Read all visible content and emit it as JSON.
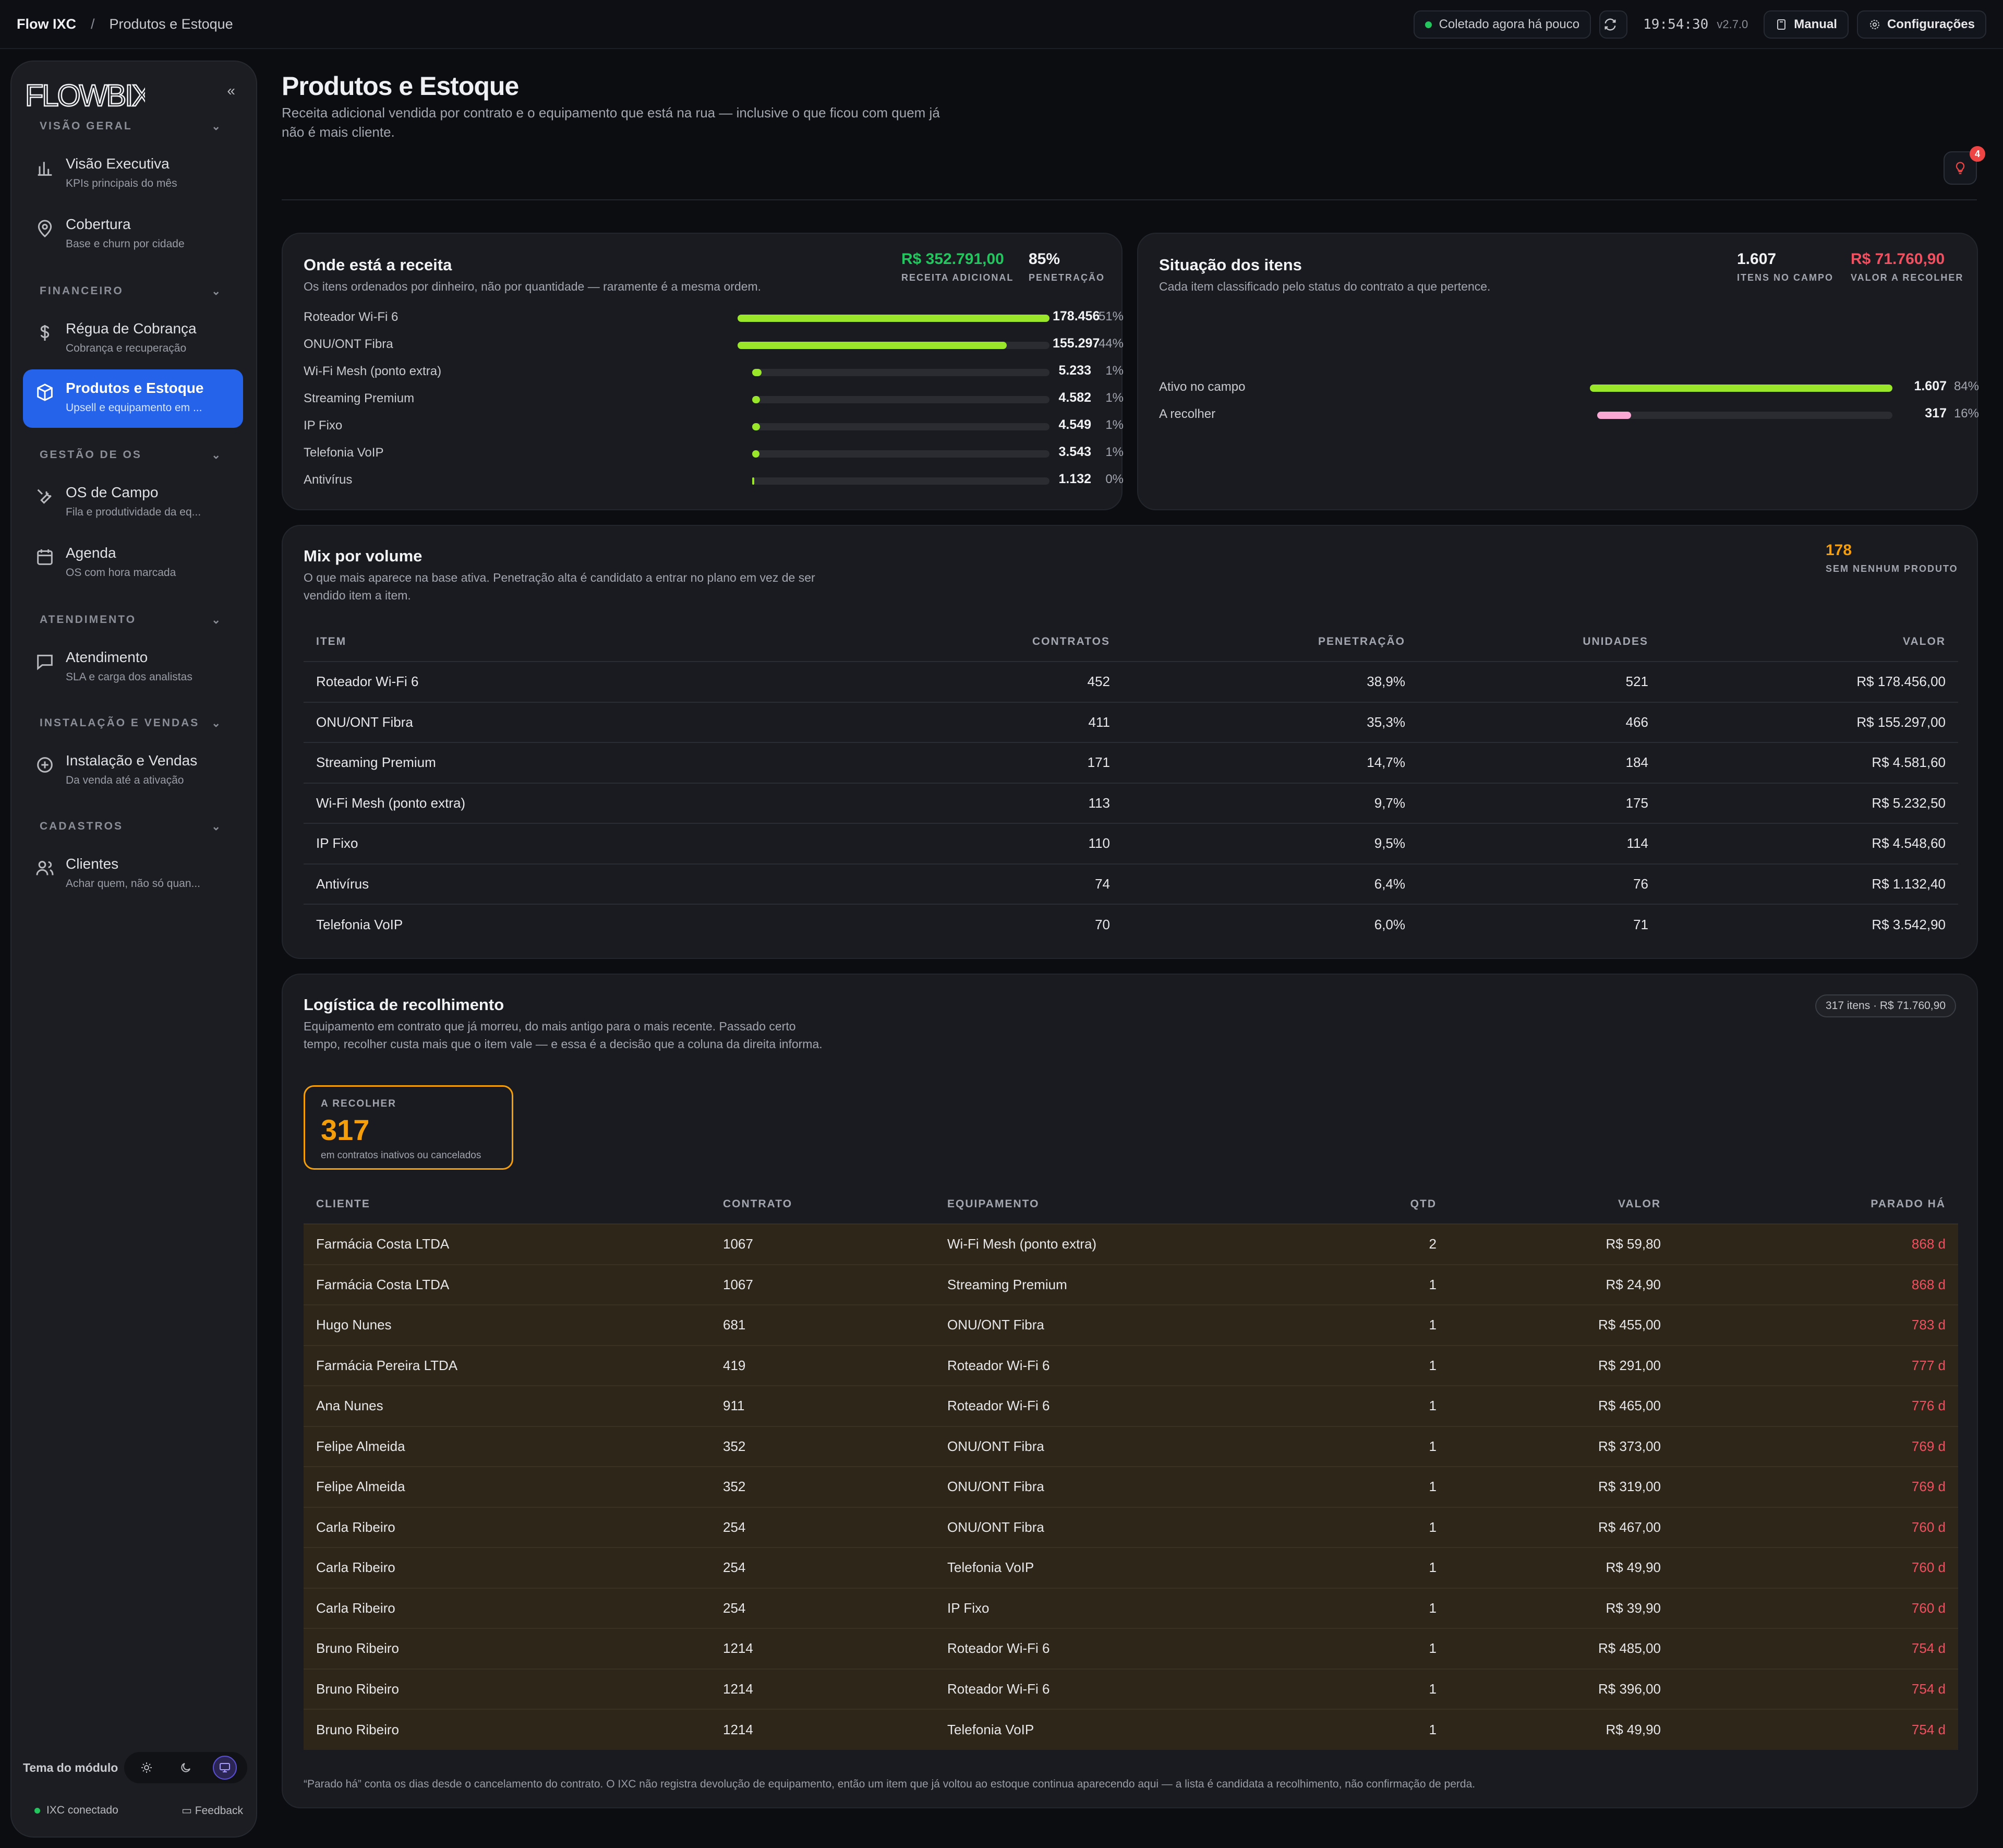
{
  "topbar": {
    "brand": "Flow IXC",
    "separator": "/",
    "page": "Produtos e Estoque",
    "status": "Coletado agora há pouco",
    "clock": "19:54:30",
    "version": "v2.7.0",
    "manual": "Manual",
    "settings": "Configurações"
  },
  "sidebar": {
    "logo": "FLOWBIX",
    "collapse": "«",
    "sections": [
      {
        "label": "VISÃO GERAL",
        "items": [
          {
            "title": "Visão Executiva",
            "subtitle": "KPIs principais do mês",
            "icon": "bar-chart-icon"
          },
          {
            "title": "Cobertura",
            "subtitle": "Base e churn por cidade",
            "icon": "map-pin-icon"
          }
        ]
      },
      {
        "label": "FINANCEIRO",
        "items": [
          {
            "title": "Régua de Cobrança",
            "subtitle": "Cobrança e recuperação",
            "icon": "dollar-icon"
          },
          {
            "title": "Produtos e Estoque",
            "subtitle": "Upsell e equipamento em ...",
            "icon": "box-icon"
          }
        ]
      },
      {
        "label": "GESTÃO DE OS",
        "items": [
          {
            "title": "OS de Campo",
            "subtitle": "Fila e produtividade da eq...",
            "icon": "wrench-icon"
          },
          {
            "title": "Agenda",
            "subtitle": "OS com hora marcada",
            "icon": "calendar-icon"
          }
        ]
      },
      {
        "label": "ATENDIMENTO",
        "items": [
          {
            "title": "Atendimento",
            "subtitle": "SLA e carga dos analistas",
            "icon": "chat-icon"
          }
        ]
      },
      {
        "label": "INSTALAÇÃO E VENDAS",
        "items": [
          {
            "title": "Instalação e Vendas",
            "subtitle": "Da venda até a ativação",
            "icon": "plus-circle-icon"
          }
        ]
      },
      {
        "label": "CADASTROS",
        "items": [
          {
            "title": "Clientes",
            "subtitle": "Achar quem, não só quan...",
            "icon": "users-icon"
          }
        ]
      }
    ],
    "theme_label": "Tema do módulo",
    "connected": "IXC conectado",
    "feedback": "Feedback"
  },
  "page": {
    "title": "Produtos e Estoque",
    "subtitle": "Receita adicional vendida por contrato e o equipamento que está na rua — inclusive o que ficou com quem já não é mais cliente.",
    "alerts_badge": "4"
  },
  "revenue_card": {
    "title": "Onde está a receita",
    "subtitle": "Os itens ordenados por dinheiro, não por quantidade — raramente é a mesma ordem.",
    "kpi_value": "R$ 352.791,00",
    "kpi_label": "RECEITA ADICIONAL",
    "kpi2_value": "85%",
    "kpi2_label": "PENETRAÇÃO",
    "rows": [
      {
        "name": "Roteador Wi-Fi 6",
        "value": "178.456",
        "pct": "51%",
        "fraction": 0.51
      },
      {
        "name": "ONU/ONT Fibra",
        "value": "155.297",
        "pct": "44%",
        "fraction": 0.44
      },
      {
        "name": "Wi-Fi Mesh (ponto extra)",
        "value": "5.233",
        "pct": "1%",
        "fraction": 0.015
      },
      {
        "name": "Streaming Premium",
        "value": "4.582",
        "pct": "1%",
        "fraction": 0.013
      },
      {
        "name": "IP Fixo",
        "value": "4.549",
        "pct": "1%",
        "fraction": 0.013
      },
      {
        "name": "Telefonia VoIP",
        "value": "3.543",
        "pct": "1%",
        "fraction": 0.01
      },
      {
        "name": "Antivírus",
        "value": "1.132",
        "pct": "0%",
        "fraction": 0.003
      }
    ],
    "bar_color": "#9ae62a"
  },
  "status_card": {
    "title": "Situação dos itens",
    "subtitle": "Cada item classificado pelo status do contrato a que pertence.",
    "kpi_value": "1.607",
    "kpi_label": "ITENS NO CAMPO",
    "kpi2_value": "R$ 71.760,90",
    "kpi2_label": "VALOR A RECOLHER",
    "rows": [
      {
        "name": "Ativo no campo",
        "value": "1.607",
        "pct": "84%",
        "fraction": 0.84,
        "color": "#9ae62a"
      },
      {
        "name": "A recolher",
        "value": "317",
        "pct": "16%",
        "fraction": 0.16,
        "color": "#f9a8d4"
      }
    ]
  },
  "mix_card": {
    "title": "Mix por volume",
    "subtitle": "O que mais aparece na base ativa. Penetração alta é candidato a entrar no plano em vez de ser vendido item a item.",
    "kpi_value": "178",
    "kpi_label": "SEM NENHUM PRODUTO",
    "columns": [
      "ITEM",
      "CONTRATOS",
      "PENETRAÇÃO",
      "UNIDADES",
      "VALOR"
    ],
    "rows": [
      [
        "Roteador Wi-Fi 6",
        "452",
        "38,9%",
        "521",
        "R$ 178.456,00"
      ],
      [
        "ONU/ONT Fibra",
        "411",
        "35,3%",
        "466",
        "R$ 155.297,00"
      ],
      [
        "Streaming Premium",
        "171",
        "14,7%",
        "184",
        "R$ 4.581,60"
      ],
      [
        "Wi-Fi Mesh (ponto extra)",
        "113",
        "9,7%",
        "175",
        "R$ 5.232,50"
      ],
      [
        "IP Fixo",
        "110",
        "9,5%",
        "114",
        "R$ 4.548,60"
      ],
      [
        "Antivírus",
        "74",
        "6,4%",
        "76",
        "R$ 1.132,40"
      ],
      [
        "Telefonia VoIP",
        "70",
        "6,0%",
        "71",
        "R$ 3.542,90"
      ]
    ]
  },
  "logistics_card": {
    "title": "Logística de recolhimento",
    "subtitle": "Equipamento em contrato que já morreu, do mais antigo para o mais recente. Passado certo tempo, recolher custa mais que o item vale — e essa é a decisão que a coluna da direita informa.",
    "chip": "317 itens · R$ 71.760,90",
    "box_label": "A RECOLHER",
    "box_value": "317",
    "box_sub": "em contratos inativos ou cancelados",
    "columns": [
      "CLIENTE",
      "CONTRATO",
      "EQUIPAMENTO",
      "QTD",
      "VALOR",
      "PARADO HÁ"
    ],
    "rows": [
      [
        "Farmácia Costa LTDA",
        "1067",
        "Wi-Fi Mesh (ponto extra)",
        "2",
        "R$ 59,80",
        "868 d"
      ],
      [
        "Farmácia Costa LTDA",
        "1067",
        "Streaming Premium",
        "1",
        "R$ 24,90",
        "868 d"
      ],
      [
        "Hugo Nunes",
        "681",
        "ONU/ONT Fibra",
        "1",
        "R$ 455,00",
        "783 d"
      ],
      [
        "Farmácia Pereira LTDA",
        "419",
        "Roteador Wi-Fi 6",
        "1",
        "R$ 291,00",
        "777 d"
      ],
      [
        "Ana Nunes",
        "911",
        "Roteador Wi-Fi 6",
        "1",
        "R$ 465,00",
        "776 d"
      ],
      [
        "Felipe Almeida",
        "352",
        "ONU/ONT Fibra",
        "1",
        "R$ 373,00",
        "769 d"
      ],
      [
        "Felipe Almeida",
        "352",
        "ONU/ONT Fibra",
        "1",
        "R$ 319,00",
        "769 d"
      ],
      [
        "Carla Ribeiro",
        "254",
        "ONU/ONT Fibra",
        "1",
        "R$ 467,00",
        "760 d"
      ],
      [
        "Carla Ribeiro",
        "254",
        "Telefonia VoIP",
        "1",
        "R$ 49,90",
        "760 d"
      ],
      [
        "Carla Ribeiro",
        "254",
        "IP Fixo",
        "1",
        "R$ 39,90",
        "760 d"
      ],
      [
        "Bruno Ribeiro",
        "1214",
        "Roteador Wi-Fi 6",
        "1",
        "R$ 485,00",
        "754 d"
      ],
      [
        "Bruno Ribeiro",
        "1214",
        "Roteador Wi-Fi 6",
        "1",
        "R$ 396,00",
        "754 d"
      ],
      [
        "Bruno Ribeiro",
        "1214",
        "Telefonia VoIP",
        "1",
        "R$ 49,90",
        "754 d"
      ]
    ],
    "footnote": "“Parado há” conta os dias desde o cancelamento do contrato. O IXC não registra devolução de equipamento, então um item que já voltou ao estoque continua aparecendo aqui — a lista é candidata a recolhimento, não confirmação de perda."
  },
  "colors": {
    "accent": "#2563eb",
    "green": "#22c55e",
    "orange": "#f59e0b",
    "red": "#f05060"
  }
}
